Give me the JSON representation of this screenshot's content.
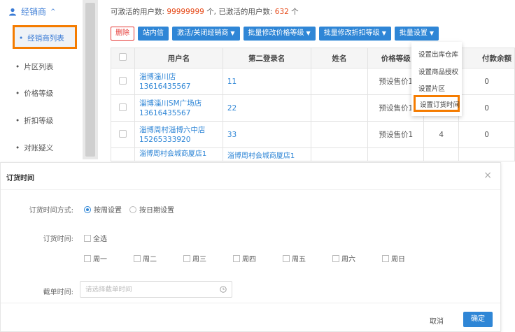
{
  "sidebar": {
    "header": "经销商",
    "items": [
      {
        "label": "经销商列表"
      },
      {
        "label": "片区列表"
      },
      {
        "label": "价格等级"
      },
      {
        "label": "折扣等级"
      },
      {
        "label": "对账疑义"
      }
    ]
  },
  "stats": {
    "activatable_label": "可激活的用户数:",
    "activatable_value": "99999999",
    "activatable_unit": "个,",
    "activated_label": "已激活的用户数:",
    "activated_value": "632",
    "activated_unit": "个"
  },
  "toolbar": {
    "delete": "删除",
    "message": "站内信",
    "toggle_dealer": "激活/关闭经销商",
    "batch_price": "批量修改价格等级",
    "batch_discount": "批量修改折扣等级",
    "batch_settings": "批量设置"
  },
  "table": {
    "headers": [
      "用户名",
      "第二登录名",
      "姓名",
      "价格等级",
      "",
      "付款余额"
    ],
    "rows": [
      {
        "user": "淄博淄川店13616435567",
        "login": "11",
        "name": "",
        "price": "预设售价1",
        "col5": "",
        "balance": "0"
      },
      {
        "user": "淄博淄川SM广场店13616435567",
        "login": "22",
        "name": "",
        "price": "预设售价1",
        "col5": "",
        "balance": "0"
      },
      {
        "user": "淄博周村淄博六中店15265333920",
        "login": "33",
        "name": "",
        "price": "预设售价1",
        "col5": "4",
        "balance": "0"
      }
    ],
    "partial_row": {
      "user": "淄博周村会城商厦店1",
      "login": "淄博周村会城商厦店1"
    }
  },
  "dropdown": {
    "items": [
      "设置出库仓库",
      "设置商品授权",
      "设置片区",
      "设置订货时间"
    ]
  },
  "dialog": {
    "title": "订货时间",
    "mode_label": "订货时间方式:",
    "mode_weekly": "按周设置",
    "mode_date": "按日期设置",
    "time_label": "订货时间:",
    "select_all": "全选",
    "days": [
      "周一",
      "周二",
      "周三",
      "周四",
      "周五",
      "周六",
      "周日"
    ],
    "cutoff_label": "截单时间:",
    "cutoff_placeholder": "请选择截单时间",
    "cancel": "取消",
    "confirm": "确定"
  },
  "colors": {
    "primary": "#2f86d6",
    "highlight": "#f57c00",
    "danger": "#e53935"
  }
}
